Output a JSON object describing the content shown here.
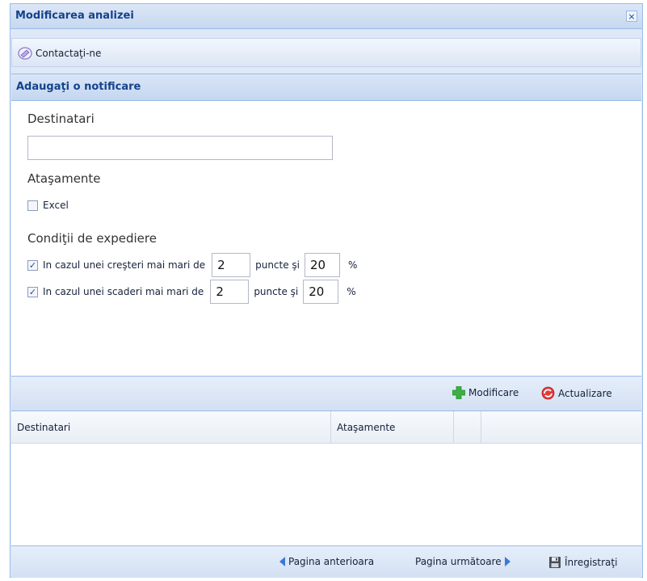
{
  "window": {
    "title": "Modificarea analizei",
    "close_symbol": "×"
  },
  "toolbar": {
    "contact_label": "Contactaţi-ne"
  },
  "section": {
    "title": "Adaugaţi o notificare"
  },
  "form": {
    "recipients_label": "Destinatari",
    "recipients_value": "",
    "attachments_label": "Ataşamente",
    "excel_label": "Excel",
    "excel_checked": false,
    "conditions_label": "Condiţii de expediere",
    "cond_increase": {
      "checked": true,
      "label": "In cazul unei creşteri mai mari de",
      "points_value": "2",
      "points_label": "puncte şi",
      "percent_value": "20",
      "percent_sign": "%"
    },
    "cond_decrease": {
      "checked": true,
      "label": "In cazul unei scaderi mai mari de",
      "points_value": "2",
      "points_label": "puncte şi",
      "percent_value": "20",
      "percent_sign": "%"
    }
  },
  "grid_toolbar": {
    "modify_label": "Modificare",
    "refresh_label": "Actualizare"
  },
  "grid": {
    "columns": [
      "Destinatari",
      "Ataşamente",
      "",
      ""
    ]
  },
  "pager": {
    "prev_label": "Pagina anterioara",
    "next_label": "Pagina următoare",
    "save_label": "Înregistraţi"
  },
  "colors": {
    "accent": "#15428b",
    "border": "#99bbe8",
    "panel": "#dfe8f6",
    "add_green": "#3cb043",
    "refresh_red": "#e23b3b"
  },
  "icons": {
    "contact": "contact-icon",
    "add": "add-icon",
    "refresh": "refresh-icon",
    "prev": "arrow-left-icon",
    "next": "arrow-right-icon",
    "save": "floppy-icon"
  }
}
